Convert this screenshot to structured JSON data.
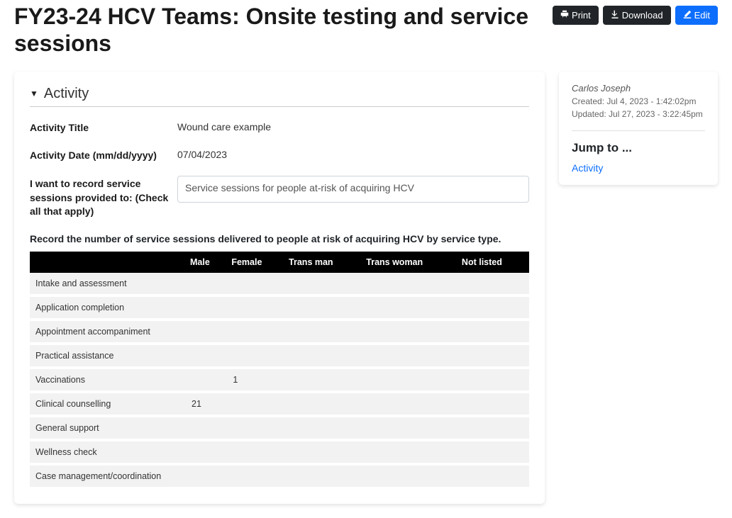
{
  "header": {
    "title": "FY23-24 HCV Teams: Onsite testing and service sessions",
    "print_label": "Print",
    "download_label": "Download",
    "edit_label": "Edit"
  },
  "sidebar": {
    "user": "Carlos Joseph",
    "created": "Created: Jul 4, 2023 - 1:42:02pm",
    "updated": "Updated: Jul 27, 2023 - 3:22:45pm",
    "jump_title": "Jump to ...",
    "jump_links": [
      "Activity"
    ]
  },
  "section": {
    "title": "Activity"
  },
  "fields": {
    "activity_title": {
      "label": "Activity Title",
      "value": "Wound care example"
    },
    "activity_date": {
      "label": "Activity Date (mm/dd/yyyy)",
      "value": "07/04/2023"
    },
    "record_for": {
      "label": "I want to record service sessions provided to: (Check all that apply)",
      "value": "Service sessions for people at-risk of acquiring HCV"
    }
  },
  "table": {
    "instruction": "Record the number of service sessions delivered to people at risk of acquiring HCV by service type.",
    "columns": [
      "",
      "Male",
      "Female",
      "Trans man",
      "Trans woman",
      "Not listed"
    ],
    "rows": [
      {
        "label": "Intake and assessment",
        "values": [
          "",
          "",
          "",
          "",
          ""
        ]
      },
      {
        "label": "Application completion",
        "values": [
          "",
          "",
          "",
          "",
          ""
        ]
      },
      {
        "label": "Appointment accompaniment",
        "values": [
          "",
          "",
          "",
          "",
          ""
        ]
      },
      {
        "label": "Practical assistance",
        "values": [
          "",
          "",
          "",
          "",
          ""
        ]
      },
      {
        "label": "Vaccinations",
        "values": [
          "",
          "1",
          "",
          "",
          ""
        ]
      },
      {
        "label": "Clinical counselling",
        "values": [
          "21",
          "",
          "",
          "",
          ""
        ]
      },
      {
        "label": "General support",
        "values": [
          "",
          "",
          "",
          "",
          ""
        ]
      },
      {
        "label": "Wellness check",
        "values": [
          "",
          "",
          "",
          "",
          ""
        ]
      },
      {
        "label": "Case management/coordination",
        "values": [
          "",
          "",
          "",
          "",
          ""
        ]
      }
    ]
  }
}
